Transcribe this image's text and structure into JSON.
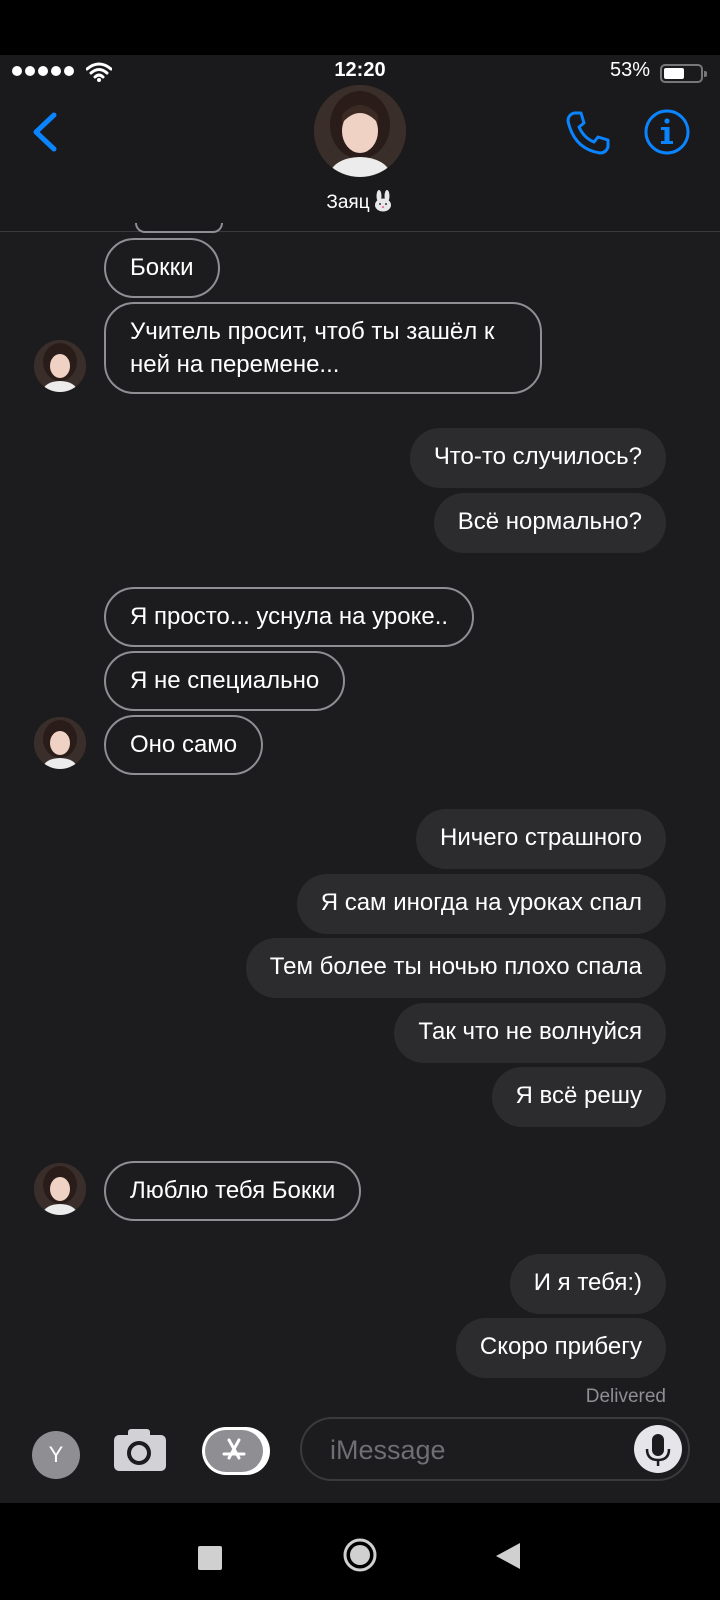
{
  "status_bar": {
    "time": "12:20",
    "battery": "53%"
  },
  "header": {
    "contact_name": "Заяц"
  },
  "messages": [
    {
      "text": "Бокки"
    },
    {
      "text": "Учитель просит, чтоб ты зашёл к ней на перемене..."
    },
    {
      "text": "Что-то случилось?"
    },
    {
      "text": "Всё нормально?"
    },
    {
      "text": "Я просто... уснула на уроке.."
    },
    {
      "text": "Я не специально"
    },
    {
      "text": "Оно само"
    },
    {
      "text": "Ничего страшного"
    },
    {
      "text": "Я сам иногда на уроках спал"
    },
    {
      "text": "Тем более ты ночью плохо спала"
    },
    {
      "text": "Так что не волнуйся"
    },
    {
      "text": "Я всё решу"
    },
    {
      "text": "Люблю тебя Бокки"
    },
    {
      "text": "И я тебя:)"
    },
    {
      "text": "Скоро прибегу"
    }
  ],
  "delivered_label": "Delivered",
  "input": {
    "y_label": "Y",
    "placeholder": "iMessage"
  },
  "colors": {
    "accent": "#0a84ff",
    "background": "#1c1c1e",
    "outgoing_bubble": "#2c2c2e"
  }
}
